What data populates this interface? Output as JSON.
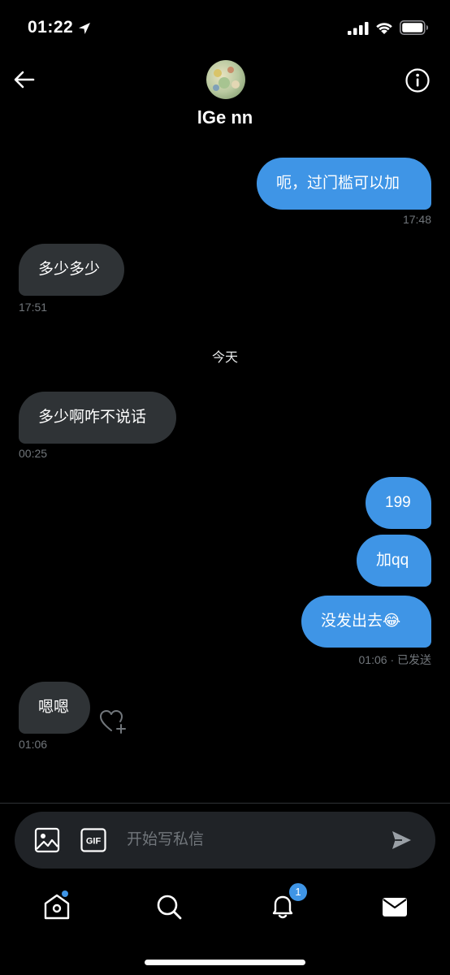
{
  "status_bar": {
    "time": "01:22"
  },
  "header": {
    "contact_name": "lGe nn"
  },
  "messages": [
    {
      "direction": "out",
      "text": "呃，过门槛可以加"
    },
    {
      "direction": "in",
      "text": "多少多少"
    },
    {
      "direction": "in",
      "text": "多少啊咋不说话"
    },
    {
      "direction": "out",
      "text": "199"
    },
    {
      "direction": "out",
      "text": "加qq"
    },
    {
      "direction": "out",
      "text": "没发出去😂"
    },
    {
      "direction": "in",
      "text": "嗯嗯"
    }
  ],
  "timestamps": {
    "t1": "17:48",
    "t2": "17:51",
    "t3": "00:25",
    "t4": "01:06 · 已发送",
    "t5": "01:06"
  },
  "day_separator": "今天",
  "composer": {
    "placeholder": "开始写私信",
    "gif_label": "GIF"
  },
  "bottom_nav": {
    "items": [
      "home",
      "search",
      "notifications",
      "messages"
    ],
    "notification_count": "1"
  },
  "colors": {
    "background": "#000000",
    "outgoing_bubble": "#3f95e6",
    "incoming_bubble": "#2f3336",
    "meta_text": "#71767b",
    "accent": "#3f95e6"
  },
  "icons": [
    "location-arrow-icon",
    "signal-icon",
    "wifi-icon",
    "battery-icon",
    "back-arrow-icon",
    "info-icon",
    "heart-plus-icon",
    "image-icon",
    "gif-icon",
    "send-icon",
    "home-icon",
    "search-icon",
    "bell-icon",
    "mail-icon"
  ]
}
